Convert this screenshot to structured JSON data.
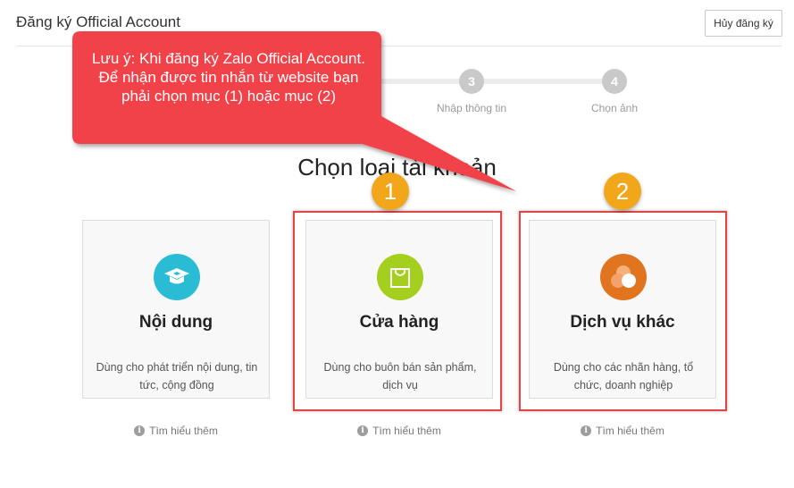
{
  "header": {
    "title": "Đăng ký Official Account",
    "cancel_label": "Hủy đăng ký"
  },
  "steps": [
    {
      "number": "3",
      "label": "Nhập thông tin"
    },
    {
      "number": "4",
      "label": "Chọn ảnh"
    }
  ],
  "main": {
    "heading": "Chọn loại tài khoản"
  },
  "cards": [
    {
      "title": "Nội dung",
      "description": "Dùng cho phát triển nội dung, tin tức, cộng đồng",
      "icon": "graduation-cap-icon",
      "icon_color": "#29bcd4",
      "learn_more": "Tìm hiểu thêm"
    },
    {
      "title": "Cửa hàng",
      "description": "Dùng cho buôn bán sản phẩm, dịch vụ",
      "icon": "shopping-bag-icon",
      "icon_color": "#a4cf1e",
      "learn_more": "Tìm hiểu thêm"
    },
    {
      "title": "Dịch vụ khác",
      "description": "Dùng cho các nhãn hàng, tổ chức, doanh nghiệp",
      "icon": "circles-icon",
      "icon_color": "#e1741f",
      "learn_more": "Tìm hiểu thêm"
    }
  ],
  "annotation": {
    "callout_text": "Lưu ý: Khi đăng ký Zalo Official Account. Để nhận được tin nhắn từ website bạn phải chọn mục (1) hoặc mục (2)",
    "callout_color": "#f2434a",
    "badge_1": "1",
    "badge_2": "2",
    "badge_color": "#f2a71b",
    "highlight_color": "#e24545"
  }
}
